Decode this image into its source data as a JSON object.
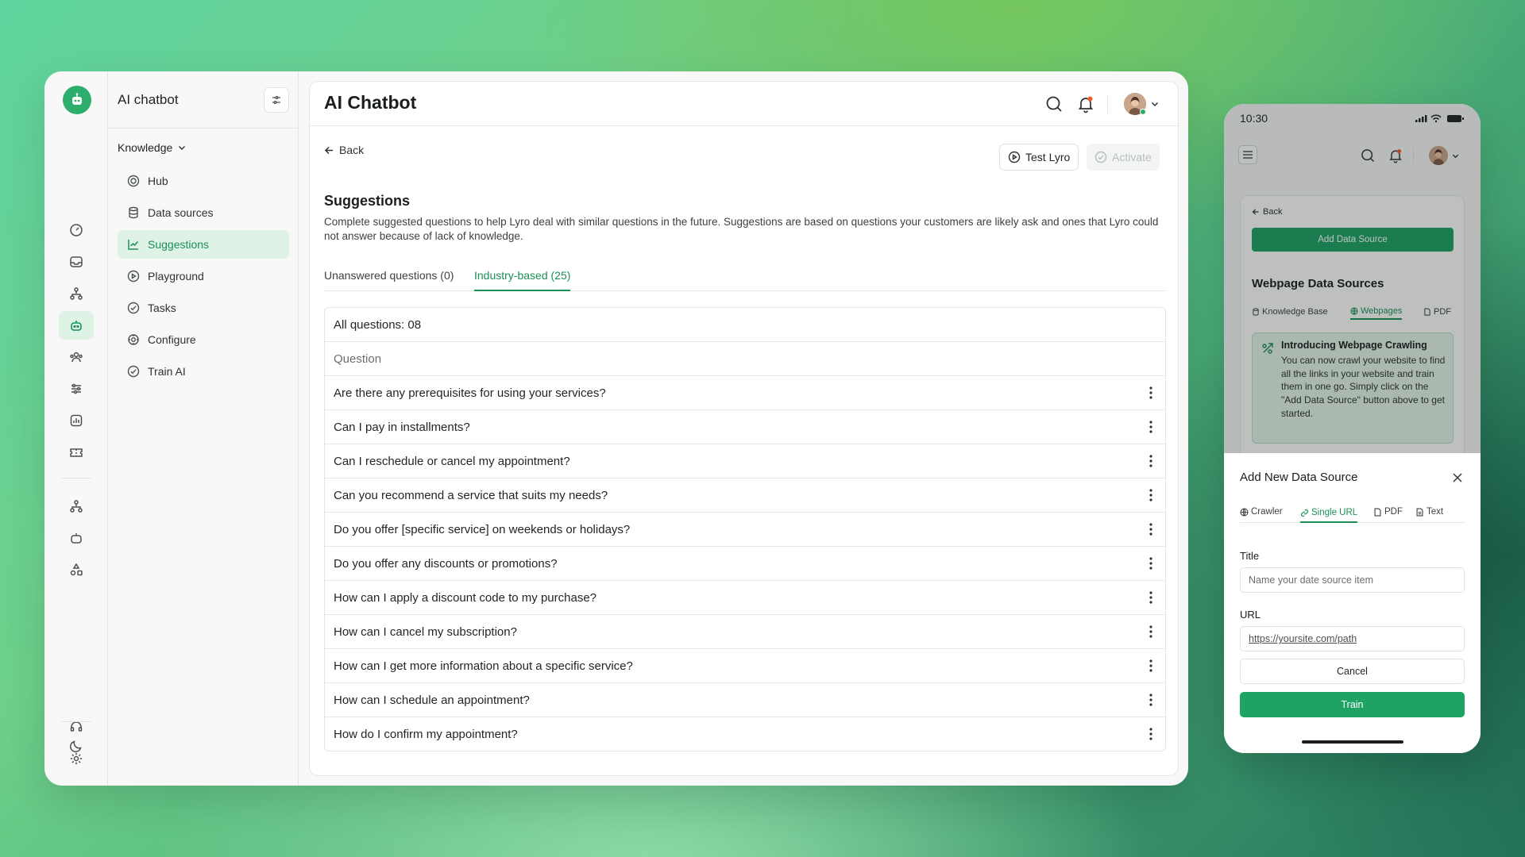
{
  "sidebar": {
    "title": "AI chatbot",
    "group_label": "Knowledge",
    "items": [
      {
        "label": "Hub",
        "icon": "hub-icon"
      },
      {
        "label": "Data sources",
        "icon": "database-icon"
      },
      {
        "label": "Suggestions",
        "icon": "chart-line-icon",
        "active": true
      },
      {
        "label": "Playground",
        "icon": "play-circle-icon"
      },
      {
        "label": "Tasks",
        "icon": "check-circle-icon"
      },
      {
        "label": "Configure",
        "icon": "cog-icon"
      },
      {
        "label": "Train AI",
        "icon": "check-circle-icon"
      }
    ]
  },
  "header": {
    "title": "AI Chatbot"
  },
  "toolbar": {
    "back_label": "Back",
    "test_label": "Test Lyro",
    "activate_label": "Activate"
  },
  "section": {
    "title": "Suggestions",
    "description": "Complete suggested questions to help Lyro deal with similar questions in the future. Suggestions are based on questions your customers are likely ask and ones that Lyro could not answer because of lack of knowledge."
  },
  "tabs": [
    {
      "label": "Unanswered questions (0)",
      "active": false
    },
    {
      "label": "Industry-based (25)",
      "active": true
    }
  ],
  "table": {
    "summary": "All questions: 08",
    "column_header": "Question",
    "rows": [
      "Are there any prerequisites for using your services?",
      "Can I pay in installments?",
      "Can I reschedule or cancel my appointment?",
      "Can you recommend a service that suits my needs?",
      "Do you offer [specific service] on weekends or holidays?",
      "Do you offer any discounts or promotions?",
      "How can I apply a discount code to my purchase?",
      "How can I cancel my subscription?",
      "How can I get more information about a specific service?",
      "How can I schedule an appointment?",
      "How do I confirm my appointment?"
    ]
  },
  "phone": {
    "time": "10:30",
    "back_label": "Back",
    "add_button": "Add Data Source",
    "heading": "Webpage Data Sources",
    "tabs": [
      {
        "label": "Knowledge Base",
        "active": false
      },
      {
        "label": "Webpages",
        "active": true
      },
      {
        "label": "PDF",
        "active": false
      }
    ],
    "info_title": "Introducing Webpage Crawling",
    "info_text": "You can  now crawl your website to find all the links in your website and train  them in one go. Simply click on the \"Add Data Source\" button above to get started.",
    "sheet": {
      "title": "Add New Data Source",
      "tabs": [
        {
          "label": "Crawler",
          "active": false
        },
        {
          "label": "Single URL",
          "active": true
        },
        {
          "label": "PDF",
          "active": false
        },
        {
          "label": "Text",
          "active": false
        }
      ],
      "title_label": "Title",
      "title_placeholder": "Name your date source item",
      "url_label": "URL",
      "url_placeholder": "https://yoursite.com/path",
      "cancel_label": "Cancel",
      "train_label": "Train"
    }
  },
  "colors": {
    "accent": "#1b8f56",
    "accent_bg": "#dff2e6",
    "button_green": "#1ea364",
    "notification": "#f25c2c"
  }
}
